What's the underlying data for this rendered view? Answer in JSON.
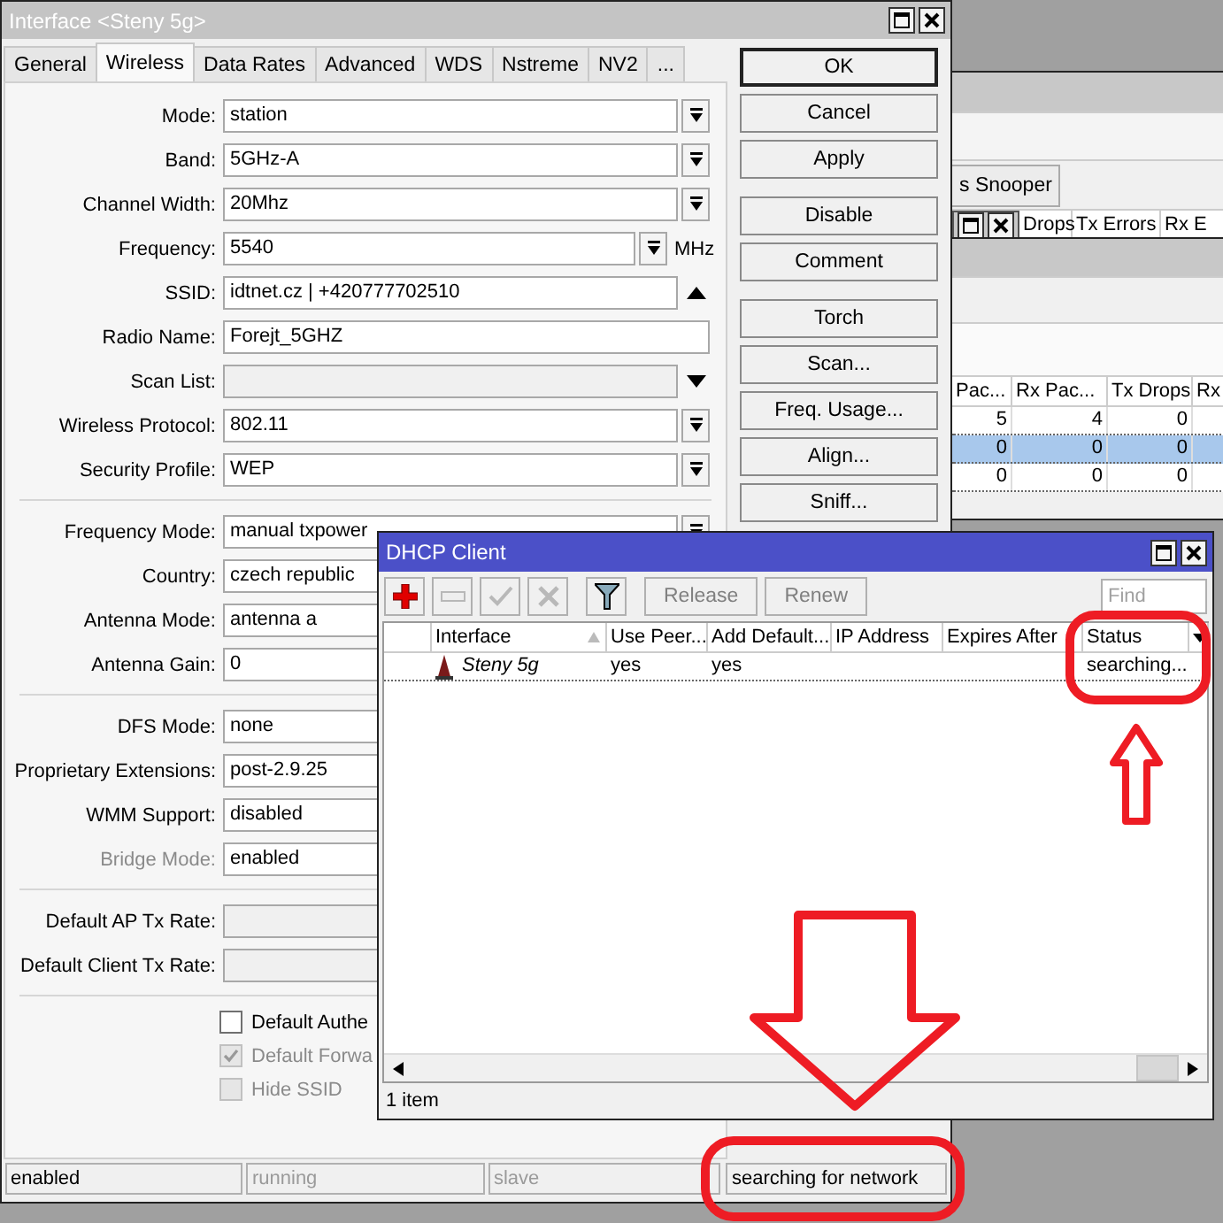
{
  "interface_window": {
    "title": "Interface <Steny 5g>",
    "tabs": [
      {
        "label": "General",
        "selected": false
      },
      {
        "label": "Wireless",
        "selected": true
      },
      {
        "label": "Data Rates",
        "selected": false
      },
      {
        "label": "Advanced",
        "selected": false
      },
      {
        "label": "WDS",
        "selected": false
      },
      {
        "label": "Nstreme",
        "selected": false
      },
      {
        "label": "NV2",
        "selected": false
      },
      {
        "label": "...",
        "selected": false
      }
    ],
    "sections": [
      {
        "rows": [
          {
            "label": "Mode:",
            "value": "station",
            "kind": "select",
            "disabled": false
          },
          {
            "label": "Band:",
            "value": "5GHz-A",
            "kind": "select",
            "disabled": false
          },
          {
            "label": "Channel Width:",
            "value": "20Mhz",
            "kind": "select",
            "disabled": false
          },
          {
            "label": "Frequency:",
            "value": "5540",
            "kind": "select",
            "unit": "MHz",
            "disabled": false
          },
          {
            "label": "SSID:",
            "value": "idtnet.cz | +420777702510",
            "kind": "history",
            "disabled": false
          },
          {
            "label": "Radio Name:",
            "value": "Forejt_5GHZ",
            "kind": "text",
            "disabled": false
          },
          {
            "label": "Scan List:",
            "kind": "list",
            "disabled": false
          },
          {
            "label": "Wireless Protocol:",
            "value": "802.11",
            "kind": "select",
            "disabled": false
          },
          {
            "label": "Security Profile:",
            "value": "WEP",
            "kind": "select",
            "disabled": false
          }
        ]
      },
      {
        "rows": [
          {
            "label": "Frequency Mode:",
            "value": "manual txpower",
            "kind": "select",
            "disabled": false
          },
          {
            "label": "Country:",
            "value": "czech republic",
            "kind": "plain",
            "disabled": false
          },
          {
            "label": "Antenna Mode:",
            "value": "antenna a",
            "kind": "plain",
            "disabled": false
          },
          {
            "label": "Antenna Gain:",
            "value": "0",
            "kind": "text",
            "disabled": false
          }
        ]
      },
      {
        "rows": [
          {
            "label": "DFS Mode:",
            "value": "none",
            "kind": "plain",
            "disabled": false
          },
          {
            "label": "Proprietary Extensions:",
            "value": "post-2.9.25",
            "kind": "plain",
            "disabled": false
          },
          {
            "label": "WMM Support:",
            "value": "disabled",
            "kind": "plain",
            "disabled": false
          },
          {
            "label": "Bridge Mode:",
            "value": "enabled",
            "kind": "plain",
            "disabled": true
          }
        ]
      },
      {
        "rows": [
          {
            "label": "Default AP Tx Rate:",
            "kind": "readonly",
            "disabled": false
          },
          {
            "label": "Default Client Tx Rate:",
            "kind": "readonly",
            "disabled": false
          }
        ]
      }
    ],
    "checkboxes": [
      {
        "label": "Default Authe",
        "checked": false,
        "disabled": false
      },
      {
        "label": "Default Forwa",
        "checked": true,
        "disabled": true
      },
      {
        "label": "Hide SSID",
        "checked": false,
        "disabled": true
      }
    ],
    "button_groups": [
      [
        {
          "label": "OK",
          "default": true
        },
        {
          "label": "Cancel",
          "default": false
        },
        {
          "label": "Apply",
          "default": false
        }
      ],
      [
        {
          "label": "Disable",
          "default": false
        },
        {
          "label": "Comment",
          "default": false
        }
      ],
      [
        {
          "label": "Torch",
          "default": false
        },
        {
          "label": "Scan...",
          "default": false
        },
        {
          "label": "Freq. Usage...",
          "default": false
        },
        {
          "label": "Align...",
          "default": false
        },
        {
          "label": "Sniff...",
          "default": false
        }
      ]
    ],
    "status_bar": [
      {
        "text": "enabled",
        "disabled": false
      },
      {
        "text": "running",
        "disabled": true
      },
      {
        "text": "slave",
        "disabled": true
      },
      {
        "text": "searching for network",
        "disabled": false
      }
    ]
  },
  "dhcp_window": {
    "title": "DHCP Client",
    "tools": [
      {
        "kind": "add",
        "disabled": false
      },
      {
        "kind": "remove",
        "disabled": true
      },
      {
        "kind": "enable",
        "disabled": true
      },
      {
        "kind": "disable",
        "disabled": true
      },
      {
        "kind": "filter",
        "disabled": false
      }
    ],
    "actions": [
      {
        "label": "Release",
        "disabled": true
      },
      {
        "label": "Renew",
        "disabled": true
      }
    ],
    "find_placeholder": "Find",
    "columns": [
      {
        "label": "Interface",
        "sorted": true
      },
      {
        "label": "Use Peer...",
        "sorted": false
      },
      {
        "label": "Add Default...",
        "sorted": false
      },
      {
        "label": "IP Address",
        "sorted": false
      },
      {
        "label": "Expires After",
        "sorted": false
      },
      {
        "label": "Status",
        "sorted": false
      }
    ],
    "rows": [
      {
        "cells": [
          "Steny 5g",
          "yes",
          "yes",
          null,
          null,
          "searching..."
        ]
      }
    ],
    "item_count": "1 item"
  },
  "background_windows": {
    "snooper_button": "s Snooper",
    "upper_columns": [
      "Drops",
      "Tx Errors",
      "Rx E"
    ],
    "lower_columns": [
      "Pac...",
      "Rx Pac...",
      "Tx Drops",
      "Rx"
    ],
    "lower_rows": [
      {
        "cells": [
          "5",
          "4",
          "0"
        ],
        "selected": false
      },
      {
        "cells": [
          "0",
          "0",
          "0"
        ],
        "selected": true
      },
      {
        "cells": [
          "0",
          "0",
          "0"
        ],
        "selected": false
      }
    ]
  }
}
